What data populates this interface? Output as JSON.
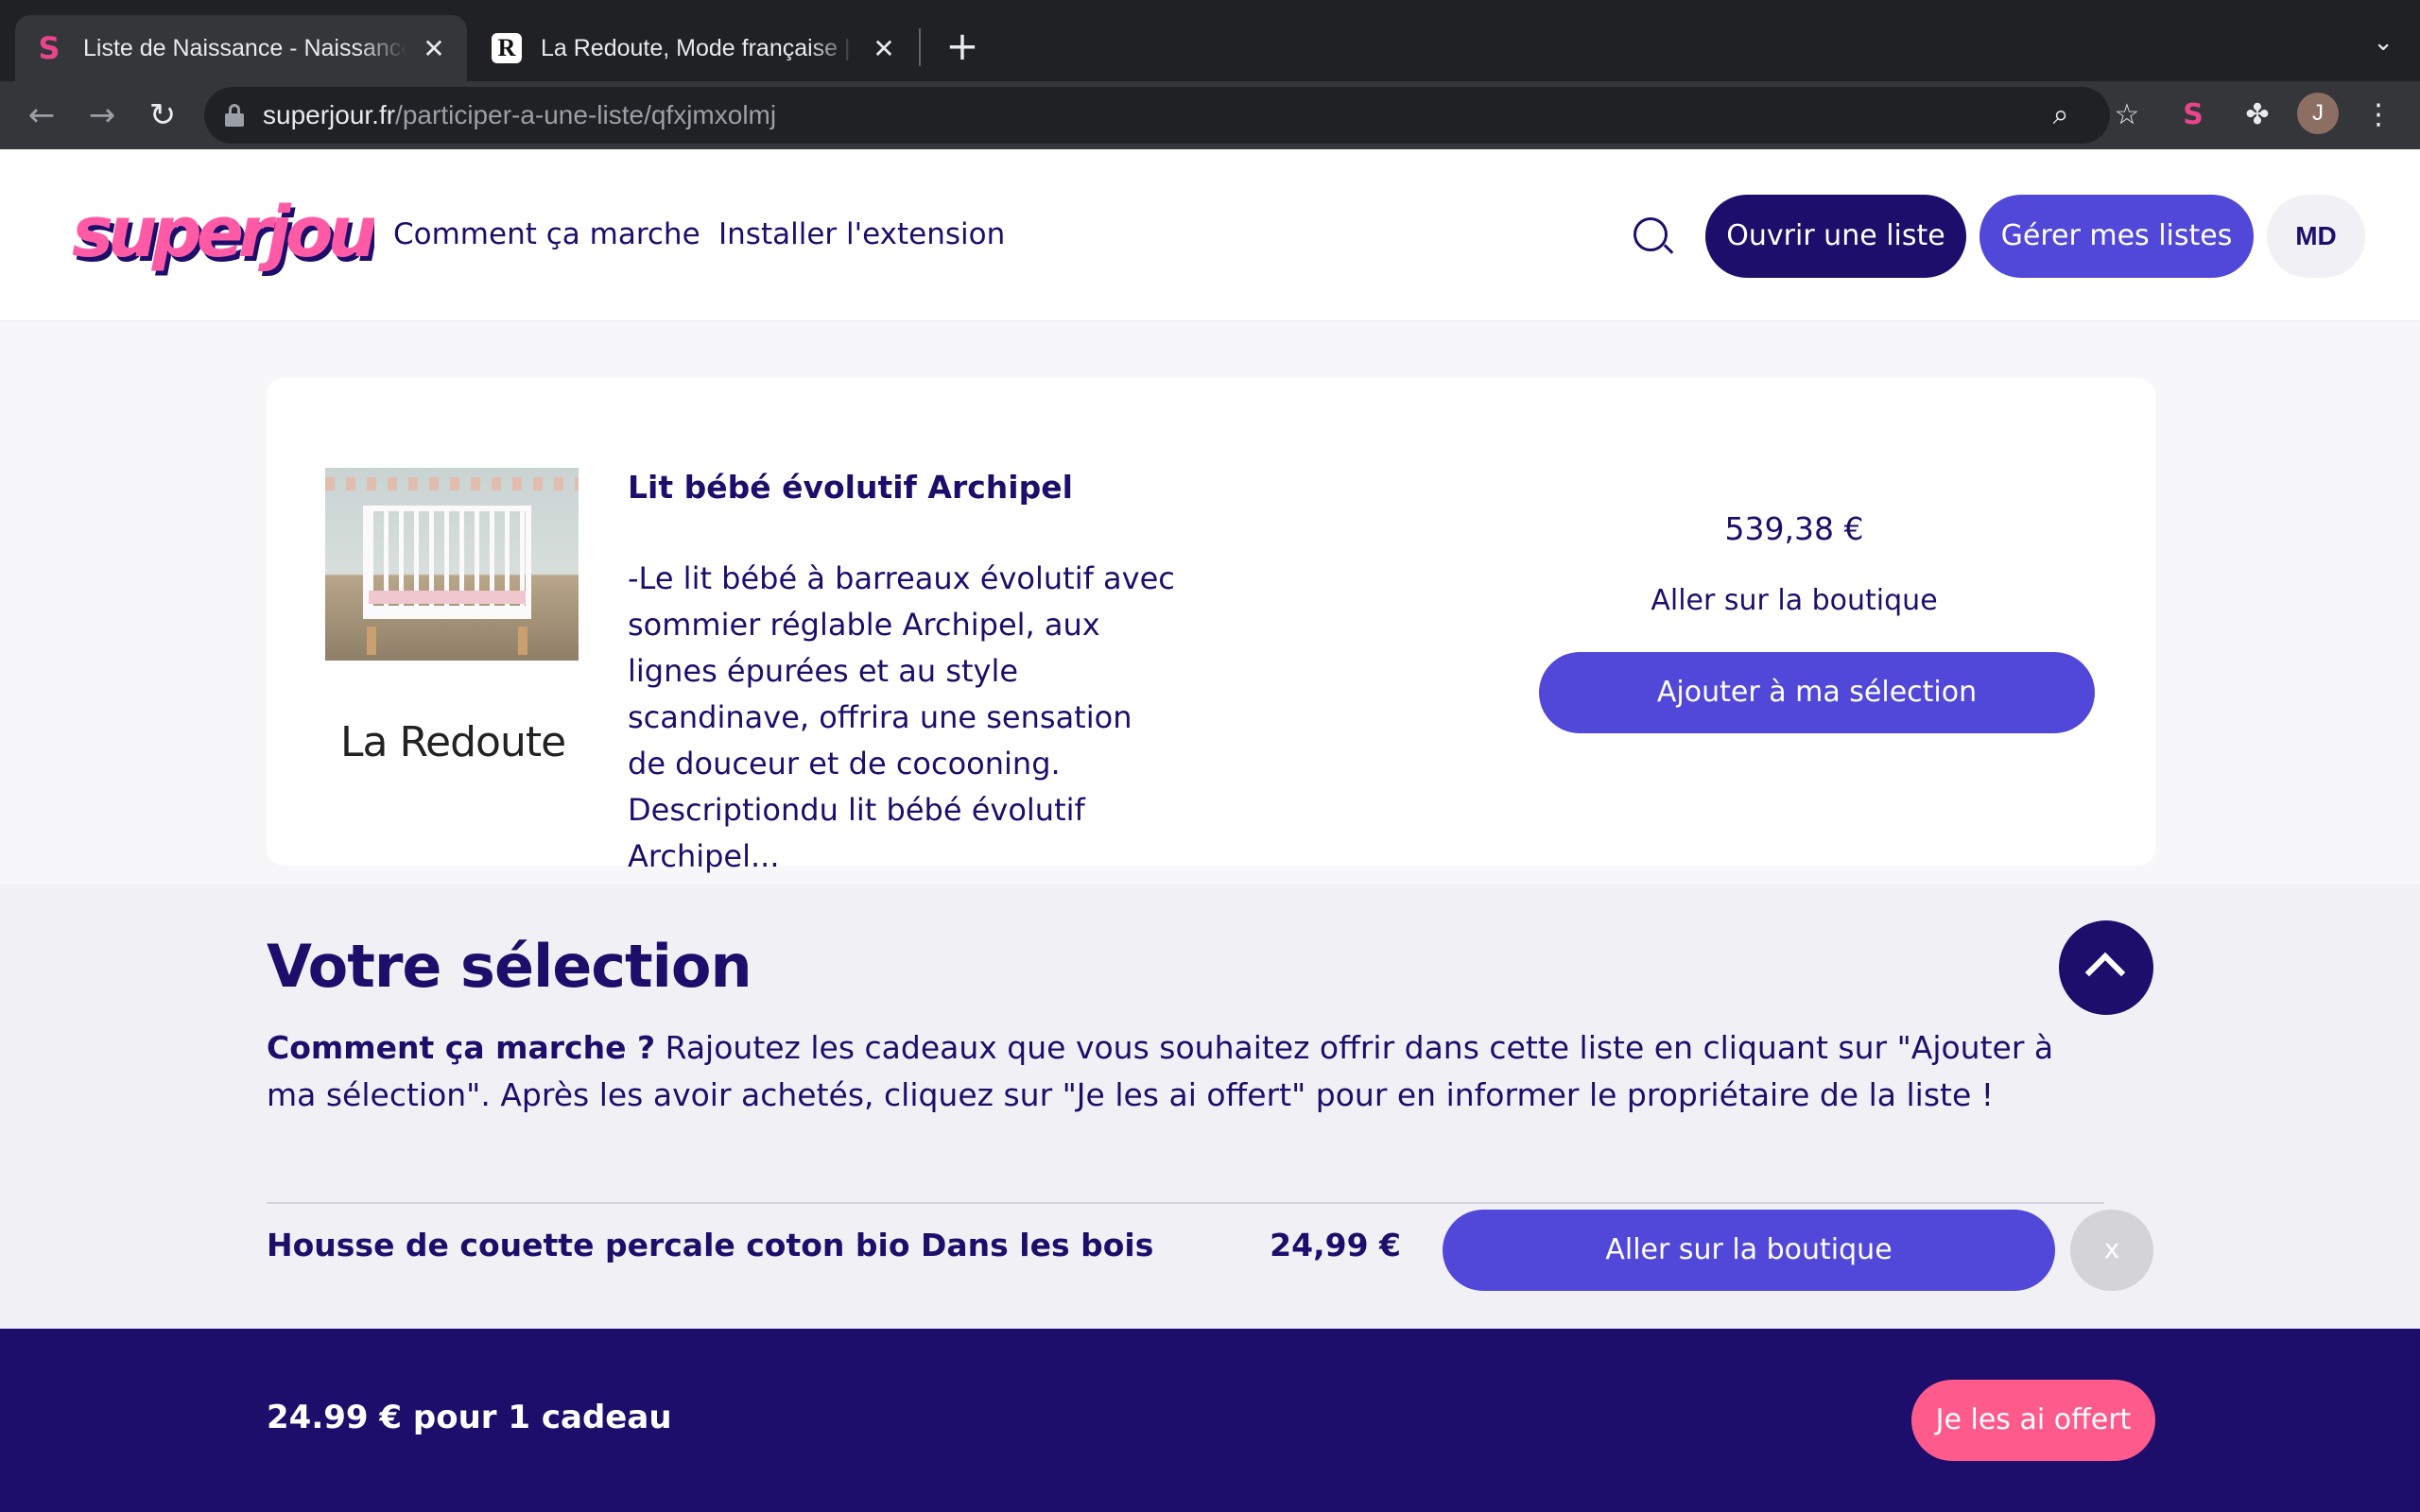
{
  "browser": {
    "tabs": [
      {
        "title": "Liste de Naissance - Naissance",
        "favicon": "S",
        "active": true
      },
      {
        "title": "La Redoute, Mode française | L",
        "favicon": "R",
        "active": false
      }
    ],
    "new_tab_icon": "+",
    "tab_menu_icon": "⌄",
    "close_icon": "✕",
    "address": {
      "host": "superjour.fr",
      "path": "/participer-a-une-liste/qfxjmxolmj"
    },
    "profile_initial": "J"
  },
  "header": {
    "logo_text": "superjour",
    "nav": {
      "how_it_works": "Comment ça marche",
      "install_extension": "Installer l'extension"
    },
    "buttons": {
      "open_list": "Ouvrir une liste",
      "manage_lists": "Gérer mes listes",
      "user_initials": "MD"
    }
  },
  "product": {
    "title": "Lit bébé évolutif Archipel",
    "description": "-Le lit bébé à barreaux évolutif avec sommier réglable Archipel, aux lignes épurées et au style scandinave, offrira une sensation de douceur et de cocooning. Descriptiondu lit bébé évolutif Archipel...",
    "merchant": "La Redoute",
    "price": "539,38 €",
    "shop_link": "Aller sur la boutique",
    "add_button": "Ajouter à ma sélection"
  },
  "selection": {
    "title": "Votre sélection",
    "how_label": "Comment ça marche ?",
    "how_text": " Rajoutez les cadeaux que vous souhaitez offrir dans cette liste en cliquant sur \"Ajouter à ma sélection\". Après les avoir achetés, cliquez sur \"Je les ai offert\" pour en informer le propriétaire de la liste !",
    "items": [
      {
        "name": "Housse de couette percale coton bio Dans les bois",
        "price": "24,99 €",
        "shop_button": "Aller sur la boutique",
        "remove_button": "x"
      }
    ]
  },
  "footer": {
    "total": "24.99 € pour 1 cadeau",
    "offered_button": "Je les ai offert"
  },
  "colors": {
    "brand_dark": "#1d0e6b",
    "brand_primary": "#5148d9",
    "brand_pink": "#ff5a8c"
  }
}
